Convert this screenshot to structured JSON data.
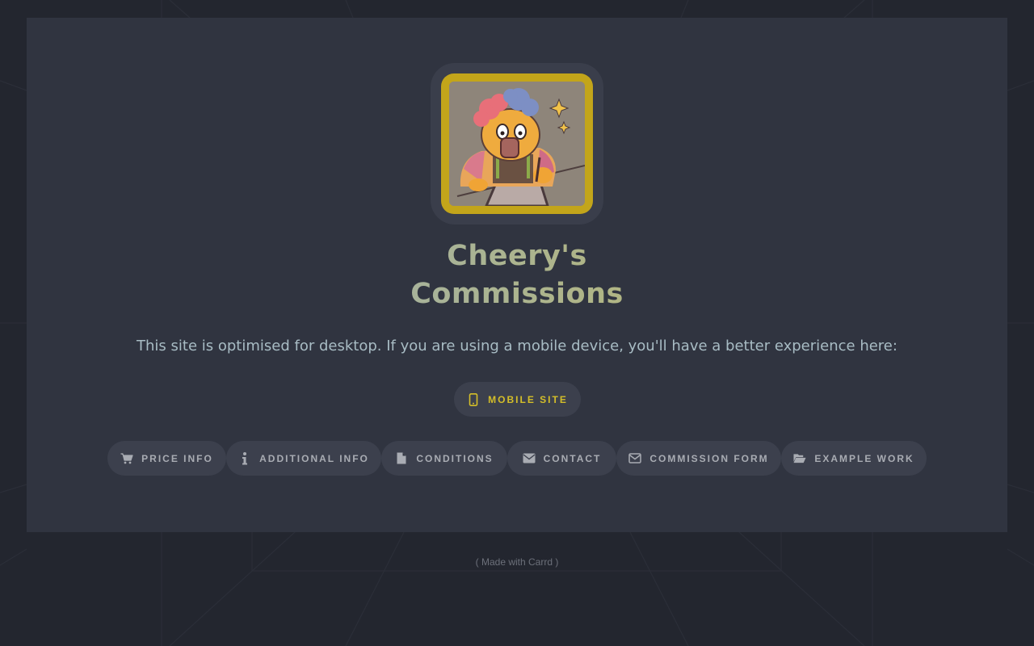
{
  "site": {
    "title_line1": "Cheery's",
    "title_line2": "Commissions",
    "notice": "This site is optimised for desktop. If you are using a mobile device, you'll have a better experience here:",
    "mobile_button": {
      "label": "MOBILE SITE",
      "icon": "mobile-phone-icon"
    }
  },
  "nav": [
    {
      "label": "PRICE INFO",
      "icon": "cart-icon"
    },
    {
      "label": "ADDITIONAL INFO",
      "icon": "info-icon"
    },
    {
      "label": "CONDITIONS",
      "icon": "document-icon"
    },
    {
      "label": "CONTACT",
      "icon": "envelope-icon"
    },
    {
      "label": "COMMISSION FORM",
      "icon": "envelope-outline-icon"
    },
    {
      "label": "EXAMPLE WORK",
      "icon": "folder-open-icon"
    }
  ],
  "footer": {
    "text": "( Made with Carrd )"
  },
  "colors": {
    "background": "#23262f",
    "card": "#303440",
    "pill": "#3c404d",
    "avatar_border": "#c3a51a",
    "accent_yellow": "#d4be29",
    "nav_text": "#a9acb3",
    "notice_text": "#a8bcc4"
  }
}
